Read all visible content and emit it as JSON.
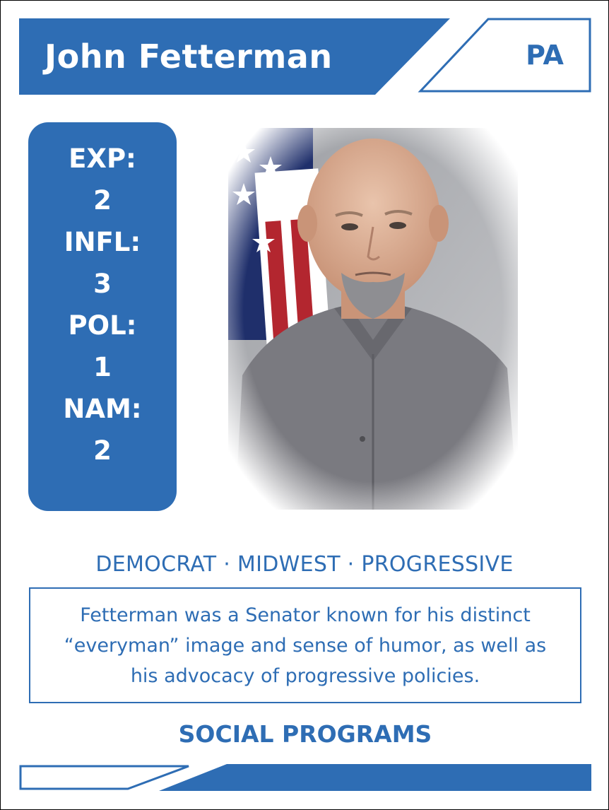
{
  "card": {
    "name": "John Fetterman",
    "state": "PA",
    "stats": [
      {
        "label": "EXP:",
        "value": "2"
      },
      {
        "label": "INFL:",
        "value": "3"
      },
      {
        "label": "POL:",
        "value": "1"
      },
      {
        "label": "NAM:",
        "value": "2"
      }
    ],
    "tags": "DEMOCRAT · MIDWEST · PROGRESSIVE",
    "description": "Fetterman was a Senator known for his distinct “everyman” image and sense of humor, as well as his advocacy of progressive policies.",
    "category": "SOCIAL PROGRAMS",
    "photo_alt": "portrait-photo"
  },
  "colors": {
    "accent": "#2e6db4",
    "background": "#ffffff",
    "text_on_accent": "#ffffff"
  }
}
